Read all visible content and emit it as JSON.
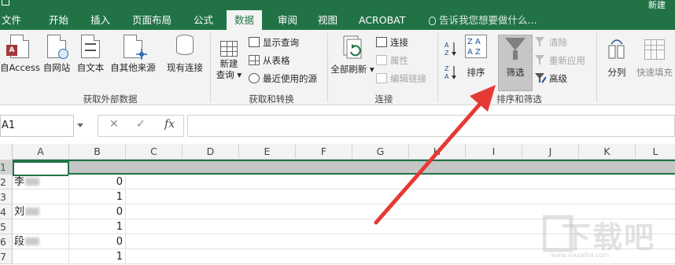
{
  "title_right": "新建 ",
  "tabs": [
    {
      "label": "文件"
    },
    {
      "label": "开始"
    },
    {
      "label": "插入"
    },
    {
      "label": "页面布局"
    },
    {
      "label": "公式"
    },
    {
      "label": "数据"
    },
    {
      "label": "审阅"
    },
    {
      "label": "视图"
    },
    {
      "label": "ACROBAT"
    }
  ],
  "active_tab": "数据",
  "tell_me": "告诉我您想要做什么...",
  "ribbon": {
    "get_external": {
      "buttons": [
        "Access",
        "自网站",
        "自文本",
        "自其他来源"
      ],
      "existing": "现有连接",
      "label": "获取外部数据",
      "access_prefix": "自"
    },
    "get_transform": {
      "new_query": "新建",
      "new_query2": "查询",
      "show_queries": "显示查询",
      "from_table": "从表格",
      "recent_sources": "最近使用的源",
      "label": "获取和转换"
    },
    "connections": {
      "refresh_all": "全部刷新",
      "connections": "连接",
      "properties": "属性",
      "edit_links": "编辑链接",
      "label": "连接"
    },
    "sort_filter": {
      "sort": "排序",
      "filter": "筛选",
      "clear": "清除",
      "reapply": "重新应用",
      "advanced": "高级",
      "label": "排序和筛选"
    },
    "data_tools": {
      "split": "分列",
      "flash_fill": "快速填充"
    }
  },
  "formula_bar": {
    "name_box": "A1",
    "cancel": "✕",
    "enter": "✓",
    "fx": "fx",
    "formula": ""
  },
  "columns": [
    "A",
    "B",
    "C",
    "D",
    "E",
    "F",
    "G",
    "H",
    "I",
    "J",
    "K",
    "L"
  ],
  "rows": [
    {
      "num": "1",
      "a": "",
      "b": ""
    },
    {
      "num": "2",
      "a": "李",
      "b": "0"
    },
    {
      "num": "3",
      "a": "",
      "b": "1"
    },
    {
      "num": "4",
      "a": "刘",
      "b": "0"
    },
    {
      "num": "5",
      "a": "",
      "b": "1"
    },
    {
      "num": "6",
      "a": "段",
      "b": "0"
    },
    {
      "num": "7",
      "a": "",
      "b": "1"
    }
  ],
  "watermark": {
    "text": "下载吧",
    "url": "www.xiazaiba.com"
  },
  "colors": {
    "excel_green": "#217346",
    "arrow": "#e53935"
  }
}
